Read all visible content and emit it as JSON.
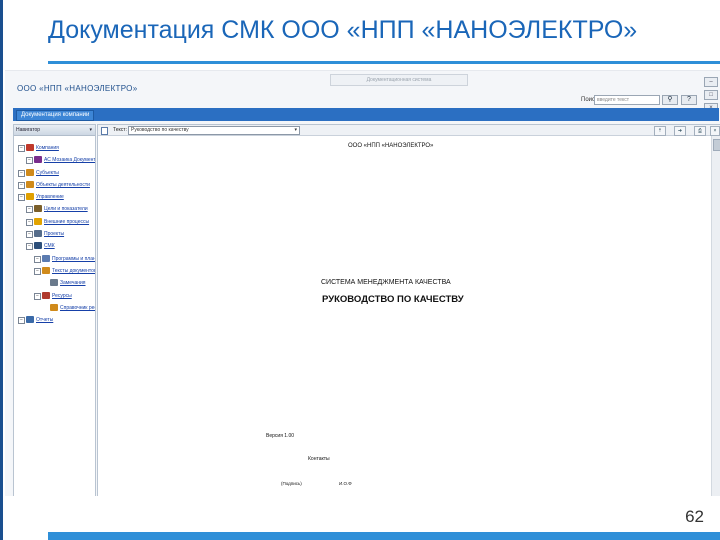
{
  "slide": {
    "title": "Документация СМК ООО «НПП «НАНОЭЛЕКТРО»",
    "page_number": "62"
  },
  "app": {
    "window_title": "Документационная система",
    "company_name": "ООО «НПП «НАНОЭЛЕКТРО»",
    "search": {
      "label": "Поиск:",
      "placeholder": "введите текст"
    },
    "nav": {
      "active_tab": "Документация компании"
    },
    "sidebar": {
      "header": "Навигатор",
      "items": [
        {
          "label": "Компания",
          "level": 0,
          "icon": "building-icon",
          "color": "#c0392b"
        },
        {
          "label": "АС Мозаика Документы",
          "level": 1,
          "icon": "grid-icon",
          "color": "#7a2d8c"
        },
        {
          "label": "Субъекты",
          "level": 0,
          "icon": "folder-icon",
          "color": "#d08a1a"
        },
        {
          "label": "Объекты деятельности",
          "level": 0,
          "icon": "folder-icon",
          "color": "#d08a1a"
        },
        {
          "label": "Управление",
          "level": 0,
          "icon": "handshake-icon",
          "color": "#e0a000"
        },
        {
          "label": "Цели и показатели",
          "level": 1,
          "icon": "target-icon",
          "color": "#7b5f2a"
        },
        {
          "label": "Внешние процессы",
          "level": 1,
          "icon": "gear-icon",
          "color": "#e2a300"
        },
        {
          "label": "Проекты",
          "level": 1,
          "icon": "hourglass-icon",
          "color": "#556c8a"
        },
        {
          "label": "СМК",
          "level": 1,
          "icon": "glasses-icon",
          "color": "#2d4f7a"
        },
        {
          "label": "Программы и планы",
          "level": 2,
          "icon": "check-icon",
          "color": "#5b7bb0"
        },
        {
          "label": "Тексты документов",
          "level": 2,
          "icon": "folder-icon",
          "color": "#d08a1a"
        },
        {
          "label": "Замечания",
          "level": 3,
          "icon": "page-icon",
          "color": "#6a7a8c"
        },
        {
          "label": "Ресурсы",
          "level": 2,
          "icon": "gift-icon",
          "color": "#b03a2e"
        },
        {
          "label": "Справочник ресурсов",
          "level": 3,
          "icon": "folder-icon",
          "color": "#d08a1a"
        },
        {
          "label": "Отчеты",
          "level": 0,
          "icon": "report-icon",
          "color": "#3a6aa8"
        }
      ]
    },
    "document": {
      "toolbar_label": "Текст:",
      "selected_document": "Руководство по качеству",
      "company": "ООО «НПП «НАНОЭЛЕКТРО»",
      "qms": "СИСТЕМА МЕНЕДЖМЕНТА КАЧЕСТВА",
      "manual": "РУКОВОДСТВО ПО КАЧЕСТВУ",
      "version": "Версия 1.00",
      "contacts": "Контакты",
      "signature_left": "(Подпись)",
      "signature_right": "И.О.Ф"
    }
  }
}
